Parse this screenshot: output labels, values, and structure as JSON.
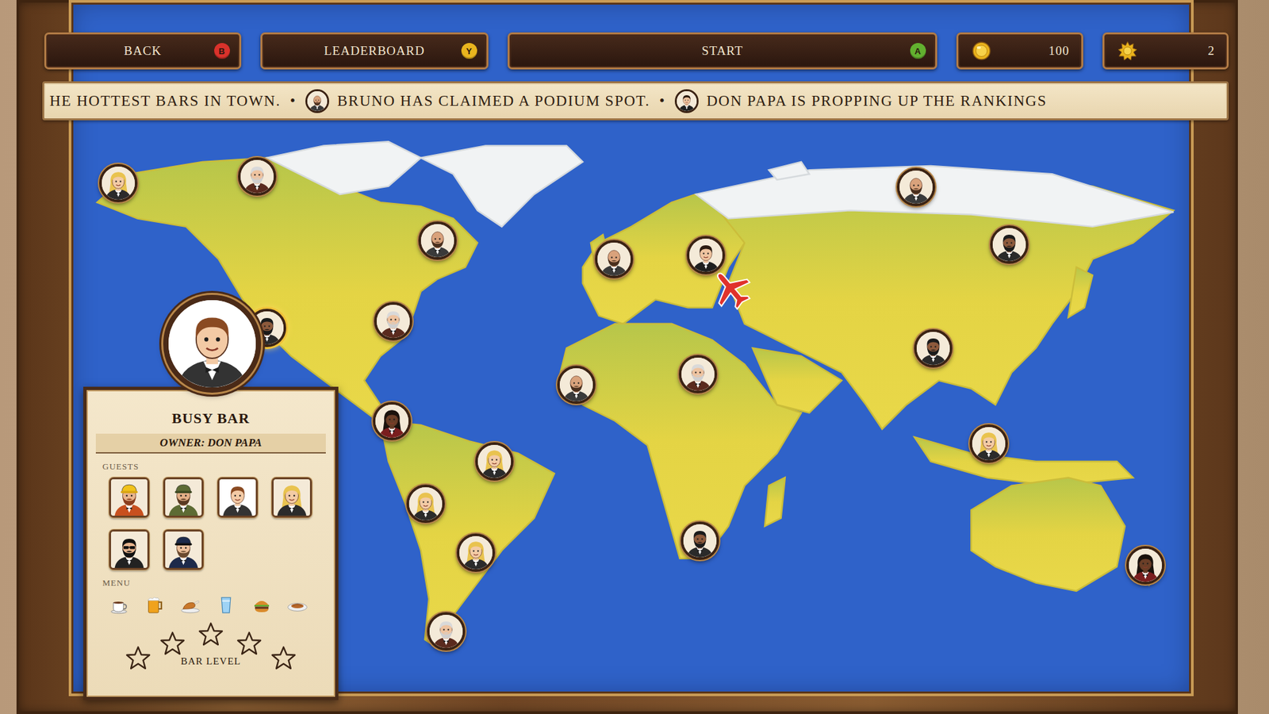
{
  "topbar": {
    "buttons": [
      {
        "label": "BACK",
        "key": "B",
        "color": "#d9322b"
      },
      {
        "label": "LEADERBOARD",
        "key": "Y",
        "color": "#e9b41e"
      },
      {
        "label": "START",
        "key": "A",
        "color": "#62b02f"
      }
    ],
    "currencies": [
      {
        "kind": "coin",
        "value": "100"
      },
      {
        "kind": "sun",
        "value": "2"
      }
    ]
  },
  "ticker": {
    "separator": "•",
    "items": [
      {
        "kind": "plain",
        "text": "HE HOTTEST BARS IN TOWN."
      },
      {
        "kind": "avatar",
        "text": "BRUNO HAS CLAIMED A PODIUM SPOT."
      },
      {
        "kind": "avatar",
        "text": "DON PAPA IS PROPPING UP THE RANKINGS"
      }
    ]
  },
  "map": {
    "pins": [
      {
        "selected": false
      },
      {
        "selected": false
      },
      {
        "selected": false
      },
      {
        "selected": false
      },
      {
        "selected": true
      },
      {
        "selected": false
      },
      {
        "selected": false
      },
      {
        "selected": false
      },
      {
        "selected": false
      },
      {
        "selected": false
      },
      {
        "selected": false
      },
      {
        "selected": false
      },
      {
        "selected": false
      },
      {
        "selected": false
      },
      {
        "selected": false
      },
      {
        "selected": false
      },
      {
        "selected": false
      },
      {
        "selected": false
      },
      {
        "selected": false
      },
      {
        "selected": false
      }
    ]
  },
  "bar_panel": {
    "title": "BUSY BAR",
    "owner": "OWNER: DON PAPA",
    "guests_label": "GUESTS",
    "guests": [
      {
        "kind": "builder"
      },
      {
        "kind": "soldier"
      },
      {
        "kind": "young-man"
      },
      {
        "kind": "blonde-woman"
      },
      {
        "kind": "sunglasses"
      },
      {
        "kind": "captain"
      }
    ],
    "menu_label": "MENU",
    "menu": [
      {
        "kind": "coffee"
      },
      {
        "kind": "beer"
      },
      {
        "kind": "chicken"
      },
      {
        "kind": "water"
      },
      {
        "kind": "burger"
      },
      {
        "kind": "dish"
      }
    ],
    "stars": 0,
    "level_label": "BAR LEVEL"
  }
}
